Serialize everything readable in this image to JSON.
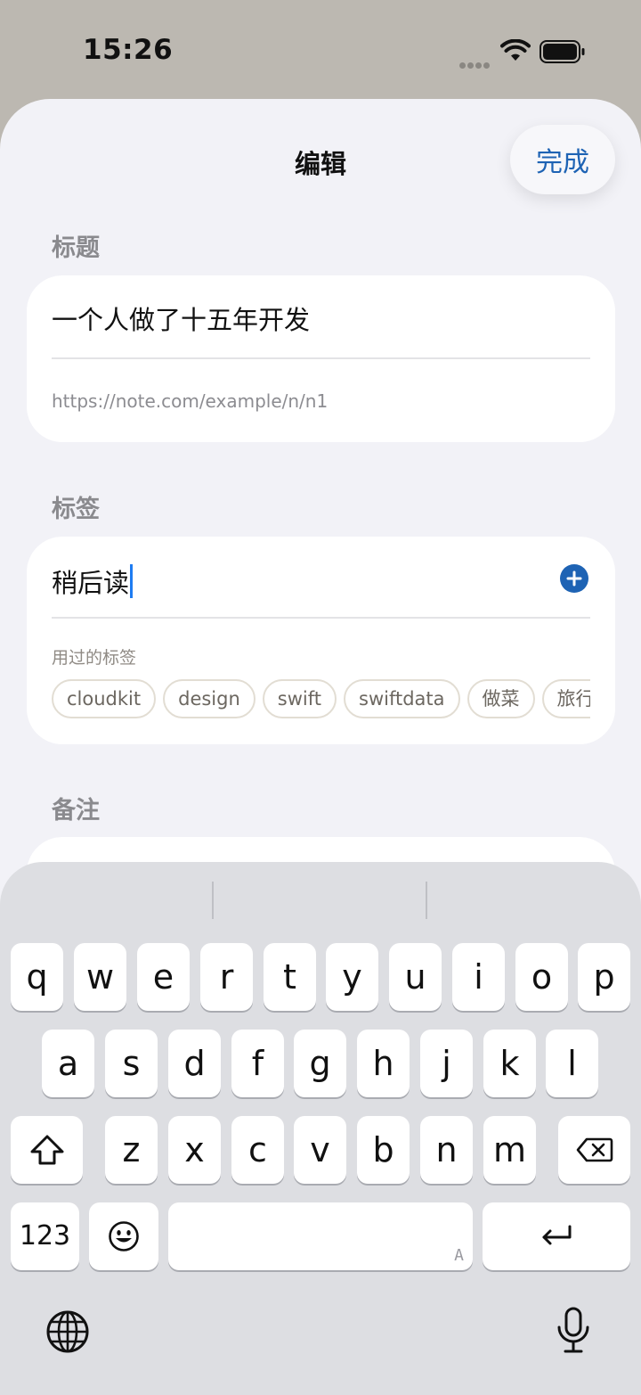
{
  "status_bar": {
    "time": "15:26"
  },
  "nav": {
    "title": "编辑",
    "done_label": "完成"
  },
  "title_section": {
    "label": "标题",
    "title_value": "一个人做了十五年开发",
    "url": "https://note.com/example/n/n1"
  },
  "tags_section": {
    "label": "标签",
    "input_value": "稍后读",
    "recent_label": "用过的标签",
    "recent_tags": [
      "cloudkit",
      "design",
      "swift",
      "swiftdata",
      "做菜",
      "旅行"
    ]
  },
  "notes_section": {
    "label": "备注"
  },
  "keyboard": {
    "row1": [
      "q",
      "w",
      "e",
      "r",
      "t",
      "y",
      "u",
      "i",
      "o",
      "p"
    ],
    "row2": [
      "a",
      "s",
      "d",
      "f",
      "g",
      "h",
      "j",
      "k",
      "l"
    ],
    "row3": [
      "z",
      "x",
      "c",
      "v",
      "b",
      "n",
      "m"
    ],
    "numbers_label": "123",
    "space_hint": "A",
    "icons": {
      "shift": "shift-icon",
      "backspace": "backspace-icon",
      "emoji": "emoji-icon",
      "return": "return-icon",
      "globe": "globe-icon",
      "mic": "microphone-icon"
    }
  },
  "colors": {
    "accent": "#1e63b4",
    "caret": "#1e7cf2",
    "sheet_bg": "#f2f2f7",
    "keyboard_bg": "#dddee2"
  }
}
